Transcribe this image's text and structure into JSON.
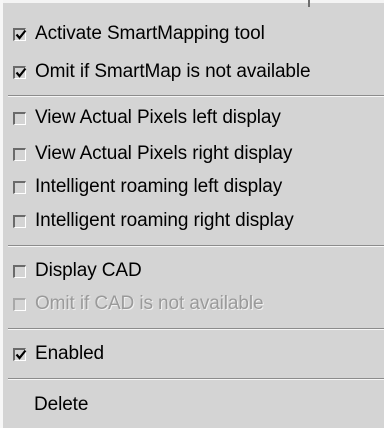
{
  "menu": {
    "items": [
      {
        "label": "Activate SmartMapping tool",
        "checked": true,
        "enabled": true
      },
      {
        "label": "Omit if SmartMap is not available",
        "checked": true,
        "enabled": true
      },
      {
        "label": "View Actual Pixels left display",
        "checked": false,
        "enabled": true
      },
      {
        "label": "View Actual Pixels right display",
        "checked": false,
        "enabled": true
      },
      {
        "label": "Intelligent roaming left display",
        "checked": false,
        "enabled": true
      },
      {
        "label": "Intelligent roaming right display",
        "checked": false,
        "enabled": true
      },
      {
        "label": "Display CAD",
        "checked": false,
        "enabled": true
      },
      {
        "label": "Omit if CAD is not available",
        "checked": false,
        "enabled": false
      },
      {
        "label": "Enabled",
        "checked": true,
        "enabled": true
      },
      {
        "label": "Delete"
      }
    ]
  },
  "colors": {
    "background": "#d4d4d4",
    "text": "#000000",
    "disabled_text": "#9a9a9a"
  }
}
